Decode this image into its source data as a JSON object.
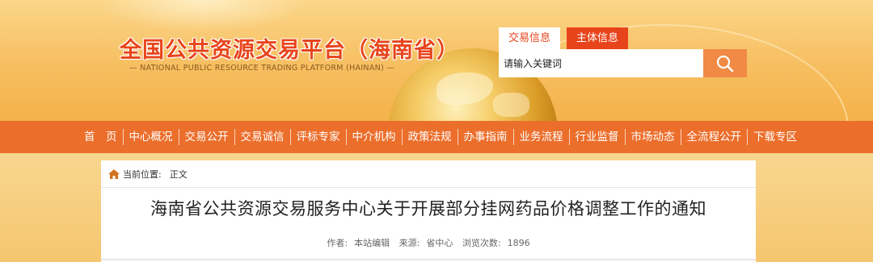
{
  "header": {
    "title": "全国公共资源交易平台（海南省）",
    "subtitle": "— NATIONAL PUBLIC RESOURCE TRADING PLATFORM (HAINAN) —"
  },
  "search": {
    "tabs": [
      {
        "label": "交易信息",
        "active": true
      },
      {
        "label": "主体信息",
        "active": false
      }
    ],
    "placeholder": "请输入关键词",
    "button_icon": "search-icon"
  },
  "nav": {
    "items": [
      {
        "label": "首　页"
      },
      {
        "label": "中心概况"
      },
      {
        "label": "交易公开"
      },
      {
        "label": "交易诚信"
      },
      {
        "label": "评标专家"
      },
      {
        "label": "中介机构"
      },
      {
        "label": "政策法规"
      },
      {
        "label": "办事指南"
      },
      {
        "label": "业务流程"
      },
      {
        "label": "行业监督"
      },
      {
        "label": "市场动态"
      },
      {
        "label": "全流程公开"
      },
      {
        "label": "下载专区"
      }
    ]
  },
  "breadcrumb": {
    "label": "当前位置:",
    "current": "正文",
    "icon": "home-icon"
  },
  "article": {
    "title": "海南省公共资源交易服务中心关于开展部分挂网药品价格调整工作的通知",
    "author_label": "作者:",
    "author": "本站编辑",
    "source_label": "来源:",
    "source": "省中心",
    "views_label": "浏览次数:",
    "views": "1896"
  },
  "colors": {
    "brand_orange": "#eb6e2b",
    "title_red": "#e8441b",
    "header_bg": "#f7be60"
  }
}
